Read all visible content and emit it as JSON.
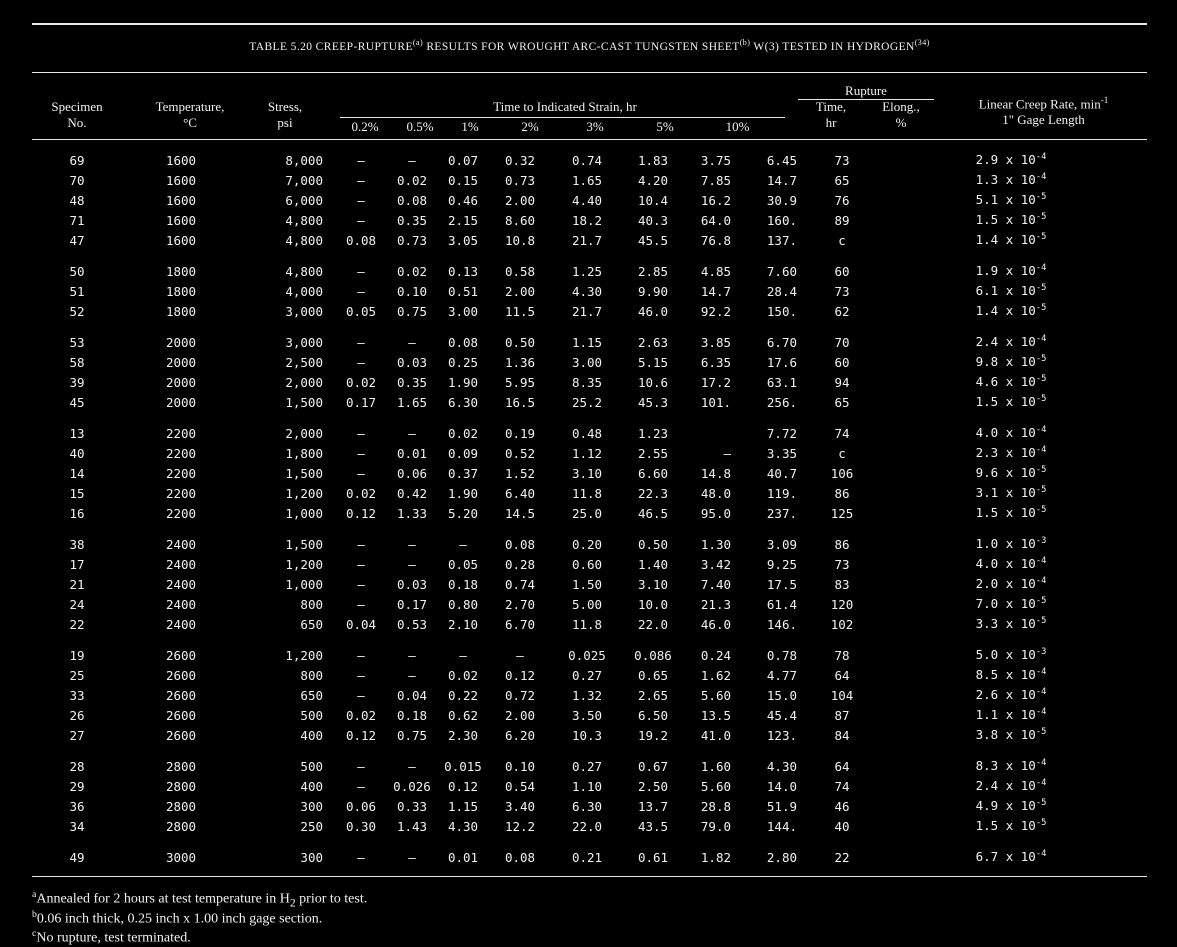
{
  "title": {
    "prefix": "TABLE 5.20   CREEP-RUPTURE",
    "sup_a": "(a)",
    "mid": " RESULTS FOR WROUGHT ARC-CAST TUNGSTEN SHEET",
    "sup_b": "(b)",
    "mid2": " W(3) TESTED IN HYDROGEN",
    "sup_ref": "(34)"
  },
  "headers": {
    "specimen_1": "Specimen",
    "specimen_2": "No.",
    "temp_1": "Temperature,",
    "temp_2": "°C",
    "stress_1": "Stress,",
    "stress_2": "psi",
    "time_group": "Time to Indicated Strain, hr",
    "strains": [
      "0.2%",
      "0.5%",
      "1%",
      "2%",
      "3%",
      "5%",
      "10%"
    ],
    "rupture_group": "Rupture",
    "rupture_time_1": "Time,",
    "rupture_time_2": "hr",
    "rupture_elong_1": "Elong.,",
    "rupture_elong_2": "%",
    "rate_1": "Linear Creep Rate, min",
    "rate_sup": "-1",
    "rate_2": "1\" Gage Length"
  },
  "rows": [
    {
      "n": "69",
      "t": "1600",
      "s": "8,000",
      "e02": "–",
      "e05": "–",
      "e1": "0.07",
      "e2": "0.32",
      "e3": "0.74",
      "e5": "1.83",
      "e10": "3.75",
      "rt": "6.45",
      "el": "73",
      "rm": "2.9 x 10",
      "rx": "-4",
      "gap": false
    },
    {
      "n": "70",
      "t": "1600",
      "s": "7,000",
      "e02": "–",
      "e05": "0.02",
      "e1": "0.15",
      "e2": "0.73",
      "e3": "1.65",
      "e5": "4.20",
      "e10": "7.85",
      "rt": "14.7",
      "el": "65",
      "rm": "1.3 x 10",
      "rx": "-4",
      "gap": false
    },
    {
      "n": "48",
      "t": "1600",
      "s": "6,000",
      "e02": "–",
      "e05": "0.08",
      "e1": "0.46",
      "e2": "2.00",
      "e3": "4.40",
      "e5": "10.4",
      "e10": "16.2",
      "rt": "30.9",
      "el": "76",
      "rm": "5.1 x 10",
      "rx": "-5",
      "gap": false
    },
    {
      "n": "71",
      "t": "1600",
      "s": "4,800",
      "e02": "–",
      "e05": "0.35",
      "e1": "2.15",
      "e2": "8.60",
      "e3": "18.2",
      "e5": "40.3",
      "e10": "64.0",
      "rt": "160.",
      "el": "89",
      "rm": "1.5 x 10",
      "rx": "-5",
      "gap": false
    },
    {
      "n": "47",
      "t": "1600",
      "s": "4,800",
      "e02": "0.08",
      "e05": "0.73",
      "e1": "3.05",
      "e2": "10.8",
      "e3": "21.7",
      "e5": "45.5",
      "e10": "76.8",
      "rt": "137.",
      "el": "c",
      "rm": "1.4 x 10",
      "rx": "-5",
      "gap": false
    },
    {
      "n": "50",
      "t": "1800",
      "s": "4,800",
      "e02": "–",
      "e05": "0.02",
      "e1": "0.13",
      "e2": "0.58",
      "e3": "1.25",
      "e5": "2.85",
      "e10": "4.85",
      "rt": "7.60",
      "el": "60",
      "rm": "1.9 x 10",
      "rx": "-4",
      "gap": true
    },
    {
      "n": "51",
      "t": "1800",
      "s": "4,000",
      "e02": "–",
      "e05": "0.10",
      "e1": "0.51",
      "e2": "2.00",
      "e3": "4.30",
      "e5": "9.90",
      "e10": "14.7",
      "rt": "28.4",
      "el": "73",
      "rm": "6.1 x 10",
      "rx": "-5",
      "gap": false
    },
    {
      "n": "52",
      "t": "1800",
      "s": "3,000",
      "e02": "0.05",
      "e05": "0.75",
      "e1": "3.00",
      "e2": "11.5",
      "e3": "21.7",
      "e5": "46.0",
      "e10": "92.2",
      "rt": "150.",
      "el": "62",
      "rm": "1.4 x 10",
      "rx": "-5",
      "gap": false
    },
    {
      "n": "53",
      "t": "2000",
      "s": "3,000",
      "e02": "–",
      "e05": "–",
      "e1": "0.08",
      "e2": "0.50",
      "e3": "1.15",
      "e5": "2.63",
      "e10": "3.85",
      "rt": "6.70",
      "el": "70",
      "rm": "2.4 x 10",
      "rx": "-4",
      "gap": true
    },
    {
      "n": "58",
      "t": "2000",
      "s": "2,500",
      "e02": "–",
      "e05": "0.03",
      "e1": "0.25",
      "e2": "1.36",
      "e3": "3.00",
      "e5": "5.15",
      "e10": "6.35",
      "rt": "17.6",
      "el": "60",
      "rm": "9.8 x 10",
      "rx": "-5",
      "gap": false
    },
    {
      "n": "39",
      "t": "2000",
      "s": "2,000",
      "e02": "0.02",
      "e05": "0.35",
      "e1": "1.90",
      "e2": "5.95",
      "e3": "8.35",
      "e5": "10.6",
      "e10": "17.2",
      "rt": "63.1",
      "el": "94",
      "rm": "4.6 x 10",
      "rx": "-5",
      "gap": false
    },
    {
      "n": "45",
      "t": "2000",
      "s": "1,500",
      "e02": "0.17",
      "e05": "1.65",
      "e1": "6.30",
      "e2": "16.5",
      "e3": "25.2",
      "e5": "45.3",
      "e10": "101.",
      "rt": "256.",
      "el": "65",
      "rm": "1.5 x 10",
      "rx": "-5",
      "gap": false
    },
    {
      "n": "13",
      "t": "2200",
      "s": "2,000",
      "e02": "–",
      "e05": "–",
      "e1": "0.02",
      "e2": "0.19",
      "e3": "0.48",
      "e5": "1.23",
      "e10": "",
      "rt": "7.72",
      "el": "74",
      "rm": "4.0 x 10",
      "rx": "-4",
      "gap": true
    },
    {
      "n": "40",
      "t": "2200",
      "s": "1,800",
      "e02": "–",
      "e05": "0.01",
      "e1": "0.09",
      "e2": "0.52",
      "e3": "1.12",
      "e5": "2.55",
      "e10": "–",
      "rt": "3.35",
      "el": "c",
      "rm": "2.3 x 10",
      "rx": "-4",
      "gap": false
    },
    {
      "n": "14",
      "t": "2200",
      "s": "1,500",
      "e02": "–",
      "e05": "0.06",
      "e1": "0.37",
      "e2": "1.52",
      "e3": "3.10",
      "e5": "6.60",
      "e10": "14.8",
      "rt": "40.7",
      "el": "106",
      "rm": "9.6 x 10",
      "rx": "-5",
      "gap": false
    },
    {
      "n": "15",
      "t": "2200",
      "s": "1,200",
      "e02": "0.02",
      "e05": "0.42",
      "e1": "1.90",
      "e2": "6.40",
      "e3": "11.8",
      "e5": "22.3",
      "e10": "48.0",
      "rt": "119.",
      "el": "86",
      "rm": "3.1 x 10",
      "rx": "-5",
      "gap": false
    },
    {
      "n": "16",
      "t": "2200",
      "s": "1,000",
      "e02": "0.12",
      "e05": "1.33",
      "e1": "5.20",
      "e2": "14.5",
      "e3": "25.0",
      "e5": "46.5",
      "e10": "95.0",
      "rt": "237.",
      "el": "125",
      "rm": "1.5 x 10",
      "rx": "-5",
      "gap": false
    },
    {
      "n": "38",
      "t": "2400",
      "s": "1,500",
      "e02": "–",
      "e05": "–",
      "e1": "–",
      "e2": "0.08",
      "e3": "0.20",
      "e5": "0.50",
      "e10": "1.30",
      "rt": "3.09",
      "el": "86",
      "rm": "1.0 x 10",
      "rx": "-3",
      "gap": true
    },
    {
      "n": "17",
      "t": "2400",
      "s": "1,200",
      "e02": "–",
      "e05": "–",
      "e1": "0.05",
      "e2": "0.28",
      "e3": "0.60",
      "e5": "1.40",
      "e10": "3.42",
      "rt": "9.25",
      "el": "73",
      "rm": "4.0 x 10",
      "rx": "-4",
      "gap": false
    },
    {
      "n": "21",
      "t": "2400",
      "s": "1,000",
      "e02": "–",
      "e05": "0.03",
      "e1": "0.18",
      "e2": "0.74",
      "e3": "1.50",
      "e5": "3.10",
      "e10": "7.40",
      "rt": "17.5",
      "el": "83",
      "rm": "2.0 x 10",
      "rx": "-4",
      "gap": false
    },
    {
      "n": "24",
      "t": "2400",
      "s": "800",
      "e02": "–",
      "e05": "0.17",
      "e1": "0.80",
      "e2": "2.70",
      "e3": "5.00",
      "e5": "10.0",
      "e10": "21.3",
      "rt": "61.4",
      "el": "120",
      "rm": "7.0 x 10",
      "rx": "-5",
      "gap": false
    },
    {
      "n": "22",
      "t": "2400",
      "s": "650",
      "e02": "0.04",
      "e05": "0.53",
      "e1": "2.10",
      "e2": "6.70",
      "e3": "11.8",
      "e5": "22.0",
      "e10": "46.0",
      "rt": "146.",
      "el": "102",
      "rm": "3.3 x 10",
      "rx": "-5",
      "gap": false
    },
    {
      "n": "19",
      "t": "2600",
      "s": "1,200",
      "e02": "–",
      "e05": "–",
      "e1": "–",
      "e2": "–",
      "e3": "0.025",
      "e5": "0.086",
      "e10": "0.24",
      "rt": "0.78",
      "el": "78",
      "rm": "5.0 x 10",
      "rx": "-3",
      "gap": true
    },
    {
      "n": "25",
      "t": "2600",
      "s": "800",
      "e02": "–",
      "e05": "–",
      "e1": "0.02",
      "e2": "0.12",
      "e3": "0.27",
      "e5": "0.65",
      "e10": "1.62",
      "rt": "4.77",
      "el": "64",
      "rm": "8.5 x 10",
      "rx": "-4",
      "gap": false
    },
    {
      "n": "33",
      "t": "2600",
      "s": "650",
      "e02": "–",
      "e05": "0.04",
      "e1": "0.22",
      "e2": "0.72",
      "e3": "1.32",
      "e5": "2.65",
      "e10": "5.60",
      "rt": "15.0",
      "el": "104",
      "rm": "2.6 x 10",
      "rx": "-4",
      "gap": false
    },
    {
      "n": "26",
      "t": "2600",
      "s": "500",
      "e02": "0.02",
      "e05": "0.18",
      "e1": "0.62",
      "e2": "2.00",
      "e3": "3.50",
      "e5": "6.50",
      "e10": "13.5",
      "rt": "45.4",
      "el": "87",
      "rm": "1.1 x 10",
      "rx": "-4",
      "gap": false
    },
    {
      "n": "27",
      "t": "2600",
      "s": "400",
      "e02": "0.12",
      "e05": "0.75",
      "e1": "2.30",
      "e2": "6.20",
      "e3": "10.3",
      "e5": "19.2",
      "e10": "41.0",
      "rt": "123.",
      "el": "84",
      "rm": "3.8 x 10",
      "rx": "-5",
      "gap": false
    },
    {
      "n": "28",
      "t": "2800",
      "s": "500",
      "e02": "–",
      "e05": "–",
      "e1": "0.015",
      "e2": "0.10",
      "e3": "0.27",
      "e5": "0.67",
      "e10": "1.60",
      "rt": "4.30",
      "el": "64",
      "rm": "8.3 x 10",
      "rx": "-4",
      "gap": true
    },
    {
      "n": "29",
      "t": "2800",
      "s": "400",
      "e02": "–",
      "e05": "0.026",
      "e1": "0.12",
      "e2": "0.54",
      "e3": "1.10",
      "e5": "2.50",
      "e10": "5.60",
      "rt": "14.0",
      "el": "74",
      "rm": "2.4 x 10",
      "rx": "-4",
      "gap": false
    },
    {
      "n": "36",
      "t": "2800",
      "s": "300",
      "e02": "0.06",
      "e05": "0.33",
      "e1": "1.15",
      "e2": "3.40",
      "e3": "6.30",
      "e5": "13.7",
      "e10": "28.8",
      "rt": "51.9",
      "el": "46",
      "rm": "4.9 x 10",
      "rx": "-5",
      "gap": false
    },
    {
      "n": "34",
      "t": "2800",
      "s": "250",
      "e02": "0.30",
      "e05": "1.43",
      "e1": "4.30",
      "e2": "12.2",
      "e3": "22.0",
      "e5": "43.5",
      "e10": "79.0",
      "rt": "144.",
      "el": "40",
      "rm": "1.5 x 10",
      "rx": "-5",
      "gap": false
    },
    {
      "n": "49",
      "t": "3000",
      "s": "300",
      "e02": "–",
      "e05": "–",
      "e1": "0.01",
      "e2": "0.08",
      "e3": "0.21",
      "e5": "0.61",
      "e10": "1.82",
      "rt": "2.80",
      "el": "22",
      "rm": "6.7 x 10",
      "rx": "-4",
      "gap": true
    }
  ],
  "footnotes": {
    "a_mark": "a",
    "a_text": "Annealed for 2 hours at test temperature in H",
    "a_sub": "2",
    "a_end": " prior to test.",
    "b_mark": "b",
    "b_text": "0.06 inch thick, 0.25 inch x 1.00 inch gage section.",
    "c_mark": "c",
    "c_text": "No rupture, test terminated."
  }
}
